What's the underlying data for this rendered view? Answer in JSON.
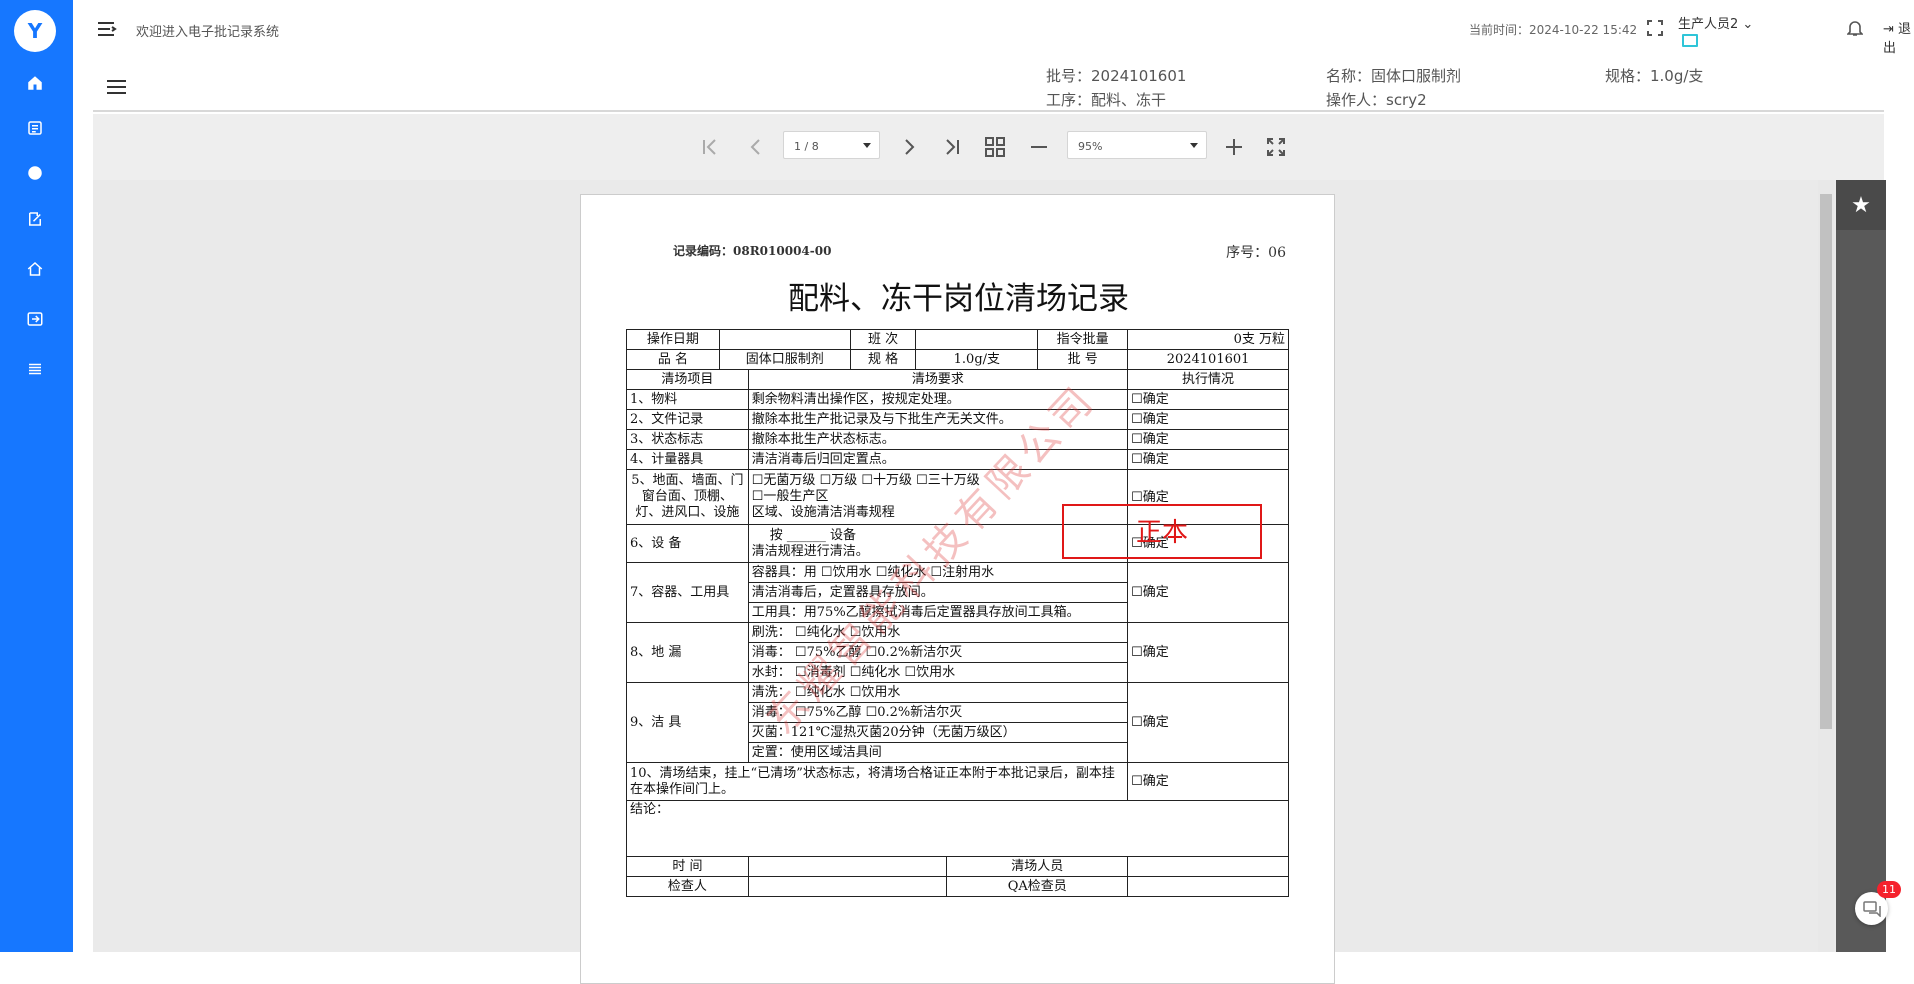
{
  "app": {
    "logo": "Y",
    "welcome": "欢迎进入电子批记录系统",
    "clock": "当前时间：2024-10-22 15:42",
    "user": "生产人员2",
    "logout": "退出"
  },
  "colors": {
    "sidebar": "#1677ff",
    "stamp": "#e01818",
    "watermark": "#dc3c3c"
  },
  "sidebar": {
    "items": [
      {
        "icon": "home-icon"
      },
      {
        "icon": "records-icon"
      },
      {
        "icon": "info-icon"
      },
      {
        "icon": "edit-icon"
      },
      {
        "icon": "house-icon"
      },
      {
        "icon": "import-icon"
      },
      {
        "icon": "list-icon"
      }
    ]
  },
  "batch": {
    "batch_no": "批号：2024101601",
    "name": "名称：固体口服制剂",
    "spec": "规格：1.0g/支",
    "process": "工序：配料、冻干",
    "operator": "操作人：scry2"
  },
  "viewer": {
    "page": "1 / 8",
    "zoom": "95%"
  },
  "document": {
    "code": "记录编码：08R010004-00",
    "seq": "序号：06",
    "title": "配料、冻干岗位清场记录",
    "op_date": "操作日期",
    "shift": "班 次",
    "order_qty": "指令批量",
    "qty_val": "0支 万粒",
    "product": "品 名",
    "product_val": "固体口服制剂",
    "spec": "规 格",
    "spec_val": "1.0g/支",
    "batch": "批 号",
    "batch_val": "2024101601",
    "h_item": "清场项目",
    "h_req": "清场要求",
    "h_exec": "执行情况",
    "r1_item": "1、物料",
    "r1_req": "剩余物料清出操作区，按规定处理。",
    "r2_item": "2、文件记录",
    "r2_req": "撤除本批生产批记录及与下批生产无关文件。",
    "r3_item": "3、状态标志",
    "r3_req": "撤除本批生产状态标志。",
    "r4_item": "4、计量器具",
    "r4_req": "清洁消毒后归回定置点。",
    "r5_item": "5、地面、墙面、门窗台面、顶棚、灯、进风口、设施",
    "r5_req1": "☐无菌万级 ☐万级 ☐十万级 ☐三十万级",
    "r5_req2": "☐一般生产区",
    "r5_req3": "区域、设施清洁消毒规程",
    "r6_item": "6、设 备",
    "r6_req1": "按 ______ 设备",
    "r6_req2": "清洁规程进行清洁。",
    "r7_item": "7、容器、工用具",
    "r7_req1": "容器具：用 ☐饮用水 ☐纯化水 ☐注射用水",
    "r7_req2": "清洁消毒后，定置器具存放间。",
    "r7_req3": "工用具：用75%乙醇擦拭消毒后定置器具存放间工具箱。",
    "r8_item": "8、地 漏",
    "r8_req1": "刷洗： ☐纯化水 ☐饮用水",
    "r8_req2": "消毒： ☐75%乙醇 ☐0.2%新洁尔灭",
    "r8_req3": "水封： ☐消毒剂 ☐纯化水 ☐饮用水",
    "r9_item": "9、洁 具",
    "r9_req1": "清洗： ☐纯化水 ☐饮用水",
    "r9_req2": "消毒： ☐75%乙醇 ☐0.2%新洁尔灭",
    "r9_req3": "灭菌：121℃湿热灭菌20分钟（无菌万级区）",
    "r9_req4": "定置：使用区域洁具间",
    "r10": "10、清场结束，挂上“已清场”状态标志，将清场合格证正本附于本批记录后，副本挂在本操作间门上。",
    "confirm": "☐确定",
    "conclusion": "结论：",
    "time": "时 间",
    "cleaner": "清场人员",
    "inspector": "检查人",
    "qa": "QA检查员",
    "stamp": "正本",
    "watermark": "东耀智能科技有限公司"
  },
  "chat": {
    "badge": "11"
  }
}
